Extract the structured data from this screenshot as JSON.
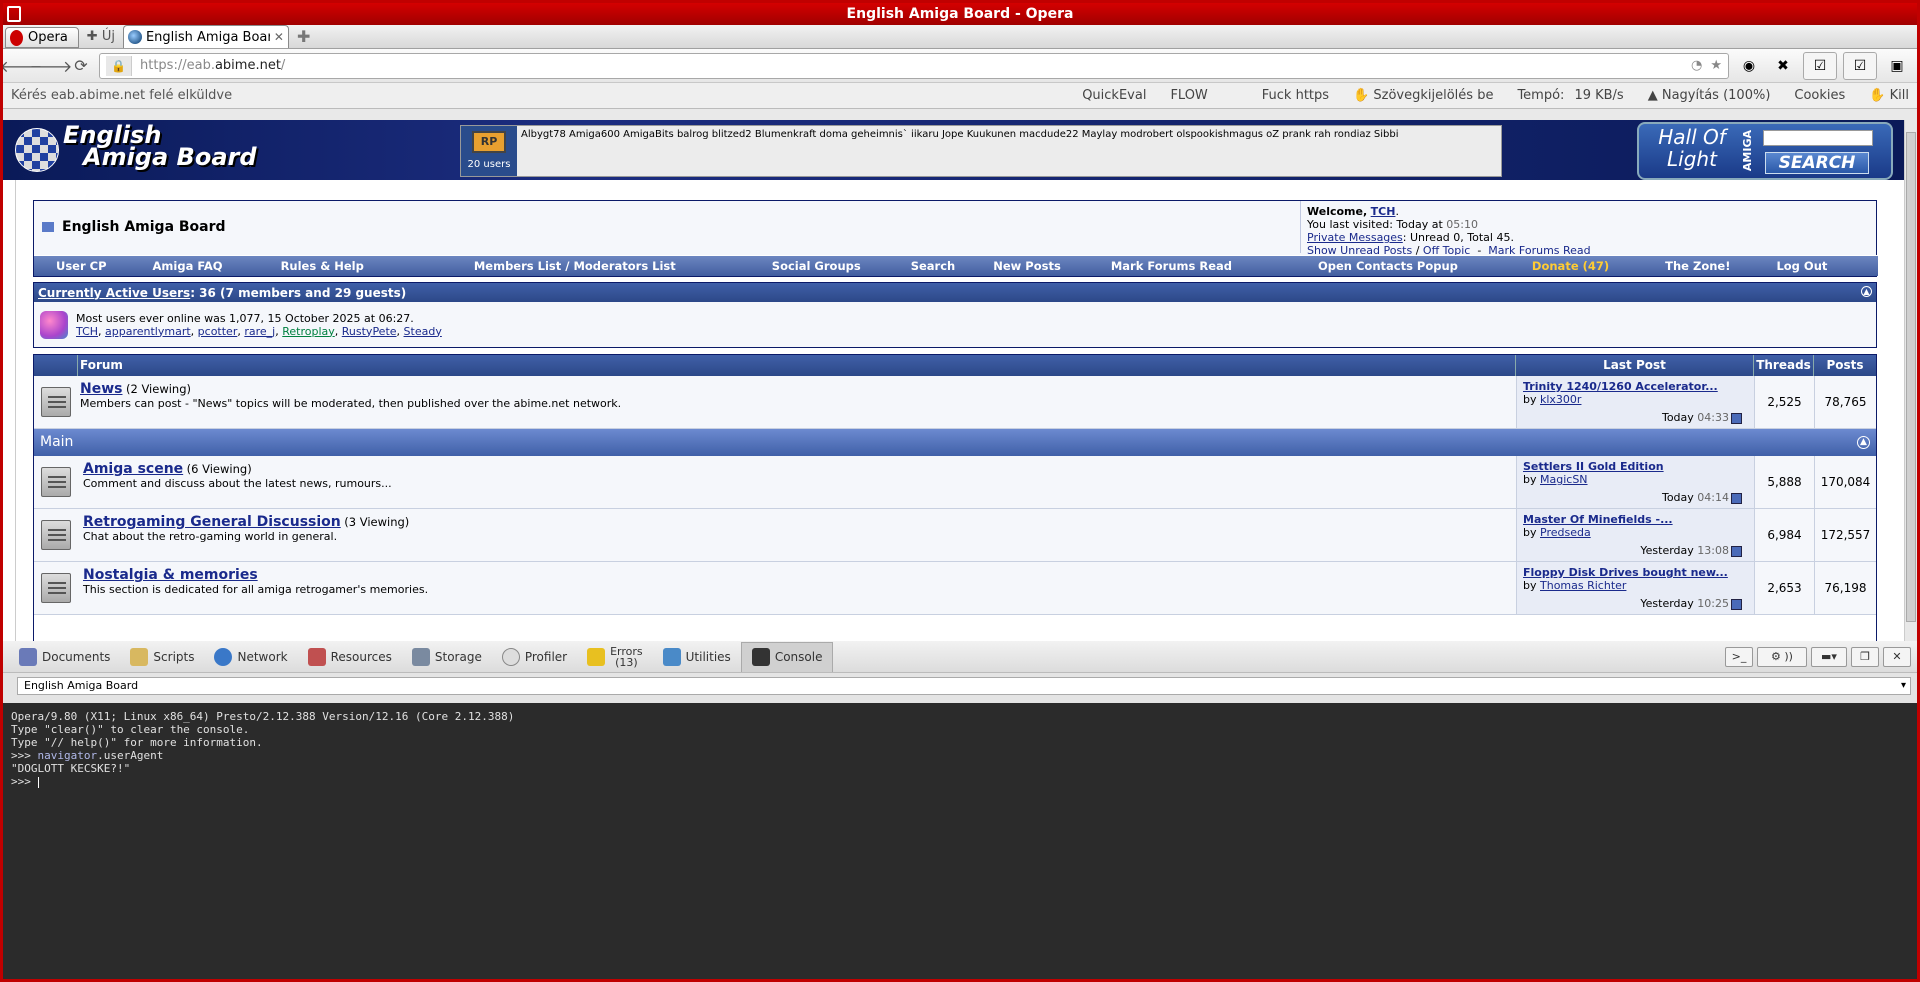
{
  "window": {
    "title": "English Amiga Board - Opera"
  },
  "tabs": {
    "menu_label": "Opera",
    "new_label": "Új",
    "active_tab": "English Amiga Board"
  },
  "nav": {
    "url_host_prefix": "https://eab.",
    "url_host": "abime.net",
    "url_path": "/"
  },
  "statusbar": {
    "message": "Kérés eab.abime.net felé elküldve",
    "items": [
      "QuickEval",
      "FLOW",
      "Fuck https",
      "Szövegkijelölés be",
      "Tempó:",
      "19 KB/s",
      "Nagyítás (100%)",
      "Cookies",
      "Kill"
    ]
  },
  "banner": {
    "logo_line1": "English",
    "logo_line2": "Amiga Board",
    "users_count": "20 users",
    "users_names": "Albygt78 Amiga600 AmigaBits balrog blitzed2 Blumenkraft doma geheimnis` iikaru Jope Kuukunen macdude22 Maylay modrobert olspookishmagus oZ prank rah rondiaz Sibbi",
    "hol_line1": "Hall Of",
    "hol_line2": "Light",
    "hol_amiga": "AMIGA",
    "hol_search": "SEARCH"
  },
  "header": {
    "board_title": "English Amiga Board",
    "welcome": "Welcome,",
    "user": "TCH",
    "last_visit": "You last visited: Today at",
    "last_visit_time": "05:10",
    "pm_label": "Private Messages",
    "pm_info": ": Unread 0, Total 45.",
    "show_unread": "Show Unread Posts",
    "off_topic": "Off Topic",
    "mark_read": "Mark Forums Read"
  },
  "navrow": {
    "items": [
      "User CP",
      "Amiga FAQ",
      "Rules & Help",
      "Members List  /  Moderators List",
      "Social Groups",
      "Search",
      "New Posts",
      "Mark Forums Read",
      "Open Contacts Popup",
      "Donate (47)",
      "The Zone!",
      "Log Out"
    ],
    "donate_color": "#ffcc33"
  },
  "active": {
    "title_link": "Currently Active Users",
    "title_rest": ": 36 (7 members and 29 guests)",
    "record": "Most users ever online was 1,077, 15 October 2025 at 06:27.",
    "users": [
      "TCH",
      "apparentlymart",
      "pcotter",
      "rare_j",
      "Retroplay",
      "RustyPete",
      "Steady"
    ]
  },
  "forum": {
    "headers": [
      "Forum",
      "Last Post",
      "Threads",
      "Posts"
    ],
    "main_category": "Main",
    "rows": [
      {
        "name": "News",
        "viewing": "(2 Viewing)",
        "desc": "Members can post - \"News\" topics will be moderated, then published over the abime.net network.",
        "last_title": "Trinity 1240/1260 Accelerator...",
        "by": "by",
        "last_user": "klx300r",
        "day": "Today",
        "time": "04:33",
        "threads": "2,525",
        "posts": "78,765"
      },
      {
        "name": "Amiga scene",
        "viewing": "(6 Viewing)",
        "desc": "Comment and discuss about the latest news, rumours...",
        "last_title": "Settlers II Gold Edition",
        "by": "by",
        "last_user": "MagicSN",
        "day": "Today",
        "time": "04:14",
        "threads": "5,888",
        "posts": "170,084"
      },
      {
        "name": "Retrogaming General Discussion",
        "viewing": "(3 Viewing)",
        "desc": "Chat about the retro-gaming world in general.",
        "last_title": "Master Of Minefields -...",
        "by": "by",
        "last_user": "Predseda",
        "day": "Yesterday",
        "time": "13:08",
        "threads": "6,984",
        "posts": "172,557"
      },
      {
        "name": "Nostalgia & memories",
        "viewing": "",
        "desc": "This section is dedicated for all amiga retrogamer's memories.",
        "last_title": "Floppy Disk Drives bought new...",
        "by": "by",
        "last_user": "Thomas Richter",
        "day": "Yesterday",
        "time": "10:25",
        "threads": "2,653",
        "posts": "76,198"
      }
    ]
  },
  "devtools": {
    "tabs": [
      "Documents",
      "Scripts",
      "Network",
      "Resources",
      "Storage",
      "Profiler",
      "Errors",
      "Utilities",
      "Console"
    ],
    "errors_count": "(13)",
    "context": "English Amiga Board",
    "console_lines": [
      "Opera/9.80 (X11; Linux x86_64) Presto/2.12.388 Version/12.16 (Core 2.12.388)",
      "Type \"clear()\" to clear the console.",
      "Type \"// help()\" for more information."
    ],
    "prompt": ">>>",
    "cmd_obj": "navigator",
    "cmd_prop": ".userAgent",
    "result": "\"DOGLOTT KECSKE?!\""
  }
}
